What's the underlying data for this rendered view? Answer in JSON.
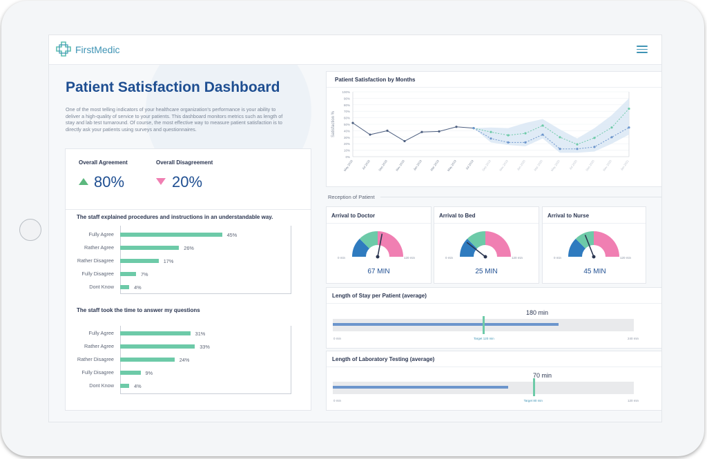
{
  "app": {
    "brand": "FirstMedic",
    "logo_icon": "medical-cross-logo",
    "menu_icon": "hamburger-menu-icon"
  },
  "header": {
    "title": "Patient Satisfaction Dashboard",
    "description": "One of the most telling indicators of your healthcare organization's performance is your ability to deliver a high-quality of service to your patients. This dashboard monitors metrics such as length of stay and lab test turnaround. Of course, the most effective way to measure patient satisfaction is to directly ask your patients using surveys and questionnaires."
  },
  "colors": {
    "accent": "#1e4e91",
    "teal": "#6dcaa8",
    "pink": "#f07fb2",
    "blue": "#2f7bbf",
    "up": "#5cb87e"
  },
  "kpis": {
    "agreement": {
      "label": "Overall Agreement",
      "value": "80%",
      "icon": "triangle-up-icon"
    },
    "disagreement": {
      "label": "Overall Disagreement",
      "value": "20%",
      "icon": "triangle-down-icon"
    }
  },
  "chart_data": [
    {
      "type": "bar",
      "title": "The staff explained procedures and instructions in an understandable way.",
      "categories": [
        "Fully Agree",
        "Rather Agree",
        "Rather Disagree",
        "Fully Disagree",
        "Dont Know"
      ],
      "values": [
        45,
        26,
        17,
        7,
        4
      ],
      "value_labels": [
        "45%",
        "26%",
        "17%",
        "7%",
        "4%"
      ],
      "xlim": [
        0,
        75
      ]
    },
    {
      "type": "bar",
      "title": "The staff took the time to answer my questions",
      "categories": [
        "Fully Agree",
        "Rather Agree",
        "Rather Disagree",
        "Fully Disagree",
        "Dont Know"
      ],
      "values": [
        31,
        33,
        24,
        9,
        4
      ],
      "value_labels": [
        "31%",
        "33%",
        "24%",
        "9%",
        "4%"
      ],
      "xlim": [
        0,
        75
      ]
    },
    {
      "type": "line",
      "title": "Patient Satisfaction by Months",
      "ylabel": "Satisfaction %",
      "ylim": [
        0,
        100
      ],
      "yticks": [
        "0%",
        "10%",
        "20%",
        "30%",
        "40%",
        "50%",
        "60%",
        "70%",
        "80%",
        "90%",
        "100%"
      ],
      "x": [
        "May 2018",
        "Jul 2018",
        "Sep 2018",
        "Nov 2018",
        "Jan 2019",
        "Mar 2019",
        "May 2019",
        "Jul 2019",
        "Sep 2019",
        "Nov 2019",
        "Jan 2020",
        "Mar 2020",
        "May 2020",
        "Jul 2020",
        "Sep 2020",
        "Nov 2020",
        "Jan 2021"
      ],
      "series": [
        {
          "values": [
            52,
            34,
            40,
            24,
            38,
            39,
            46,
            44,
            null,
            null,
            null,
            null,
            null,
            null,
            null,
            null,
            null
          ]
        },
        {
          "values": [
            null,
            null,
            null,
            null,
            null,
            null,
            null,
            44,
            38,
            33,
            36,
            48,
            30,
            19,
            29,
            45,
            74
          ]
        },
        {
          "values": [
            null,
            null,
            null,
            null,
            null,
            null,
            null,
            44,
            28,
            22,
            22,
            34,
            12,
            12,
            15,
            30,
            45
          ]
        }
      ],
      "band": {
        "upper": [
          null,
          null,
          null,
          null,
          null,
          null,
          null,
          44,
          45,
          44,
          52,
          58,
          42,
          28,
          44,
          64,
          90
        ],
        "lower": [
          null,
          null,
          null,
          null,
          null,
          null,
          null,
          44,
          22,
          18,
          16,
          28,
          6,
          6,
          8,
          20,
          34
        ]
      }
    }
  ],
  "reception": {
    "section_title": "Reception of Patient",
    "gauges": [
      {
        "title": "Arrival to Doctor",
        "value": "67 MIN",
        "min": "0 min",
        "max": "120 min",
        "fraction": 0.56
      },
      {
        "title": "Arrival to Bed",
        "value": "25 MIN",
        "min": "0 min",
        "max": "120 min",
        "fraction": 0.21
      },
      {
        "title": "Arrival to Nurse",
        "value": "45 MIN",
        "min": "0 min",
        "max": "120 min",
        "fraction": 0.38
      }
    ]
  },
  "length_of_stay": {
    "title": "Length of Stay per Patient (average)",
    "value_label": "180 min",
    "value": 180,
    "max": 240,
    "target": 120,
    "min_label": "0 min",
    "max_label": "240 min",
    "target_label": "Target 120 min"
  },
  "lab_testing": {
    "title": "Length of Laboratory Testing (average)",
    "value_label": "70 min",
    "value": 70,
    "max": 120,
    "target": 80,
    "min_label": "0 min",
    "max_label": "120 min",
    "target_label": "Target 80 min"
  }
}
